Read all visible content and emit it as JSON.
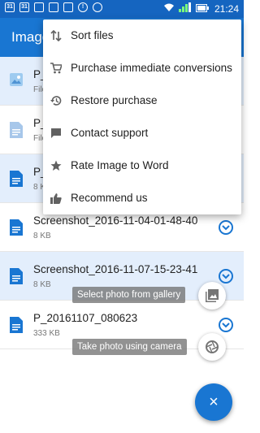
{
  "status_bar": {
    "left_icons": [
      "31",
      "31",
      "grid",
      "grid",
      "image",
      "!",
      "clock"
    ],
    "time": "21:24"
  },
  "app_bar": {
    "title": "Image"
  },
  "files": [
    {
      "name": "P_",
      "sub": "File",
      "icon": "image-icon",
      "selected": true
    },
    {
      "name": "P_",
      "sub": "File",
      "icon": "document-icon",
      "selected": false
    },
    {
      "name": "P_",
      "sub": "8 K",
      "icon": "document-icon",
      "selected": true
    },
    {
      "name": "Screenshot_2016-11-04-01-48-40",
      "sub": "8 KB",
      "icon": "document-icon",
      "selected": false
    },
    {
      "name": "Screenshot_2016-11-07-15-23-41",
      "sub": "8 KB",
      "icon": "document-icon",
      "selected": true
    },
    {
      "name": "P_20161107_080623",
      "sub": "333 KB",
      "icon": "document-icon",
      "selected": false
    }
  ],
  "actions": {
    "gallery_label": "Select photo from gallery",
    "camera_label": "Take photo using camera",
    "fab_icon": "×"
  },
  "menu": {
    "items": [
      {
        "label": "Sort files",
        "icon": "sort-icon"
      },
      {
        "label": "Purchase immediate conversions",
        "icon": "cart-icon"
      },
      {
        "label": "Restore purchase",
        "icon": "history-icon"
      },
      {
        "label": "Contact support",
        "icon": "chat-icon"
      },
      {
        "label": "Rate Image to Word",
        "icon": "star-icon"
      },
      {
        "label": "Recommend us",
        "icon": "thumbs-up-icon"
      }
    ]
  },
  "colors": {
    "primary": "#1976d2",
    "status_bar": "#1565c0",
    "selected_row": "#e3eefc"
  }
}
